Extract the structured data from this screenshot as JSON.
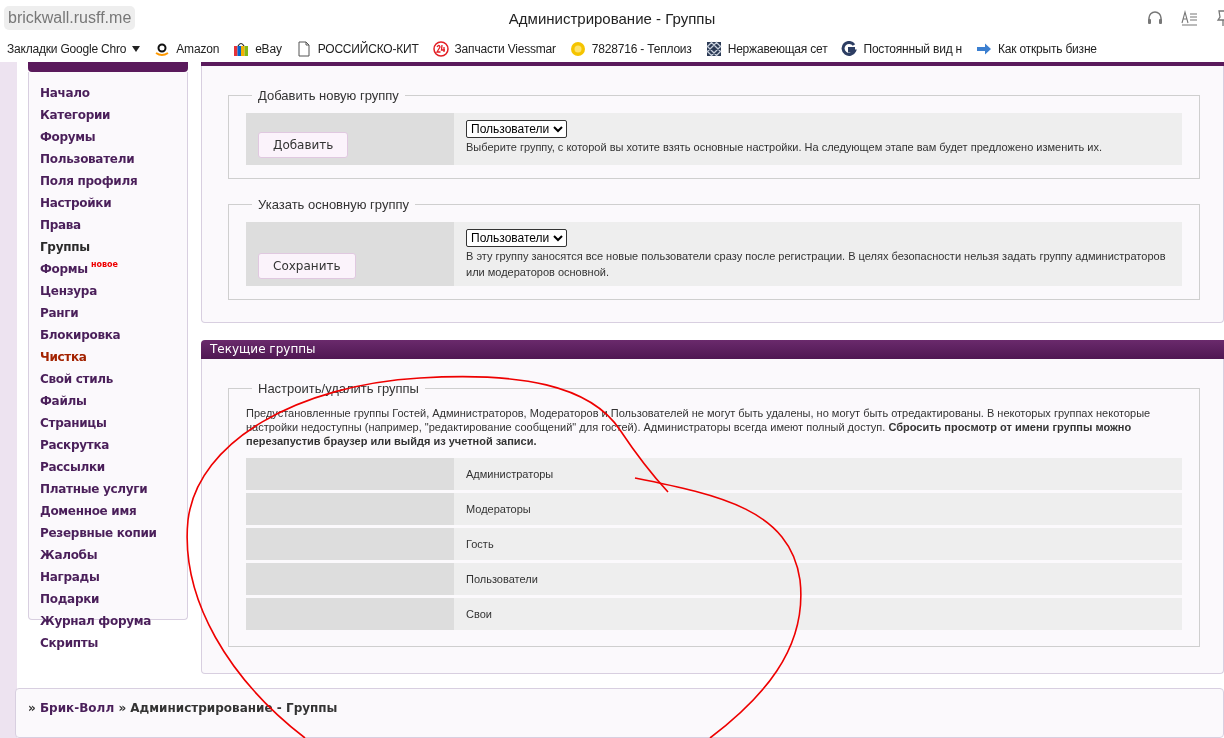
{
  "browser": {
    "address": "brickwall.rusff.me",
    "title": "Администрирование - Группы"
  },
  "bookmarks": [
    {
      "label": "Закладки Google Chro",
      "kind": "folder"
    },
    {
      "label": "Amazon",
      "kind": "amazon"
    },
    {
      "label": "eBay",
      "kind": "bag"
    },
    {
      "label": "РОССИЙСКО-КИТ",
      "kind": "page"
    },
    {
      "label": "Запчасти Viessmar",
      "kind": "badge24"
    },
    {
      "label": "7828716 - Теплоиз",
      "kind": "sun"
    },
    {
      "label": "Нержавеющая сет",
      "kind": "mesh"
    },
    {
      "label": "Постоянный вид н",
      "kind": "g"
    },
    {
      "label": "Как открыть бизне",
      "kind": "arrow"
    }
  ],
  "sidebar": {
    "items": [
      {
        "label": "Начало",
        "kind": "normal",
        "selected": false
      },
      {
        "label": "Категории",
        "kind": "normal",
        "selected": false
      },
      {
        "label": "Форумы",
        "kind": "normal",
        "selected": false
      },
      {
        "label": "Пользователи",
        "kind": "normal",
        "selected": false
      },
      {
        "label": "Поля профиля",
        "kind": "normal",
        "selected": false
      },
      {
        "label": "Настройки",
        "kind": "normal",
        "selected": false
      },
      {
        "label": "Права",
        "kind": "normal",
        "selected": false
      },
      {
        "label": "Группы",
        "kind": "normal",
        "selected": true
      },
      {
        "label": "Формы",
        "kind": "normal",
        "selected": false,
        "badge": "новое"
      },
      {
        "label": "Цензура",
        "kind": "normal",
        "selected": false
      },
      {
        "label": "Ранги",
        "kind": "normal",
        "selected": false
      },
      {
        "label": "Блокировка",
        "kind": "normal",
        "selected": false
      },
      {
        "label": "Чистка",
        "kind": "warning",
        "selected": false
      },
      {
        "label": "Свой стиль",
        "kind": "normal",
        "selected": false
      },
      {
        "label": "Файлы",
        "kind": "normal",
        "selected": false
      },
      {
        "label": "Страницы",
        "kind": "normal",
        "selected": false
      },
      {
        "label": "Раскрутка",
        "kind": "normal",
        "selected": false
      },
      {
        "label": "Рассылки",
        "kind": "normal",
        "selected": false
      },
      {
        "label": "Платные услуги",
        "kind": "normal",
        "selected": false
      },
      {
        "label": "Доменное имя",
        "kind": "normal",
        "selected": false
      },
      {
        "label": "Резервные копии",
        "kind": "normal",
        "selected": false
      },
      {
        "label": "Жалобы",
        "kind": "normal",
        "selected": false
      },
      {
        "label": "Награды",
        "kind": "normal",
        "selected": false
      },
      {
        "label": "Подарки",
        "kind": "normal",
        "selected": false
      },
      {
        "label": "Журнал форума",
        "kind": "normal",
        "selected": false
      },
      {
        "label": "Скрипты",
        "kind": "normal",
        "selected": false
      }
    ]
  },
  "forms": [
    {
      "legend": "Добавить новую группу",
      "button": "Добавить",
      "select": "Пользователи",
      "hint": "Выберите группу, с которой вы хотите взять основные настройки. На следующем этапе вам будет предложено изменить их."
    },
    {
      "legend": "Указать основную группу",
      "button": "Сохранить",
      "select": "Пользователи",
      "hint": "В эту группу заносятся все новые пользователи сразу после регистрации. В целях безопасности нельзя задать группу администраторов или модераторов основной."
    }
  ],
  "current_groups": {
    "title": "Текущие группы",
    "legend": "Настроить/удалить группы",
    "note": "Предустановленные группы Гостей, Администраторов, Модераторов и Пользователей не могут быть удалены, но могут быть отредактированы. В некоторых группах некоторые настройки недоступны (например, \"редактирование сообщений\" для гостей). Администраторы всегда имеют полный доступ. **Сбросить просмотр от имени группы можно перезапустив браузер или выйдя из учетной записи.**",
    "groups": [
      "Администраторы",
      "Модераторы",
      "Гость",
      "Пользователи",
      "Свои"
    ]
  },
  "breadcrumb": {
    "prefix": "»",
    "link": "Брик-Волл",
    "current": "» Администрирование - Группы"
  }
}
